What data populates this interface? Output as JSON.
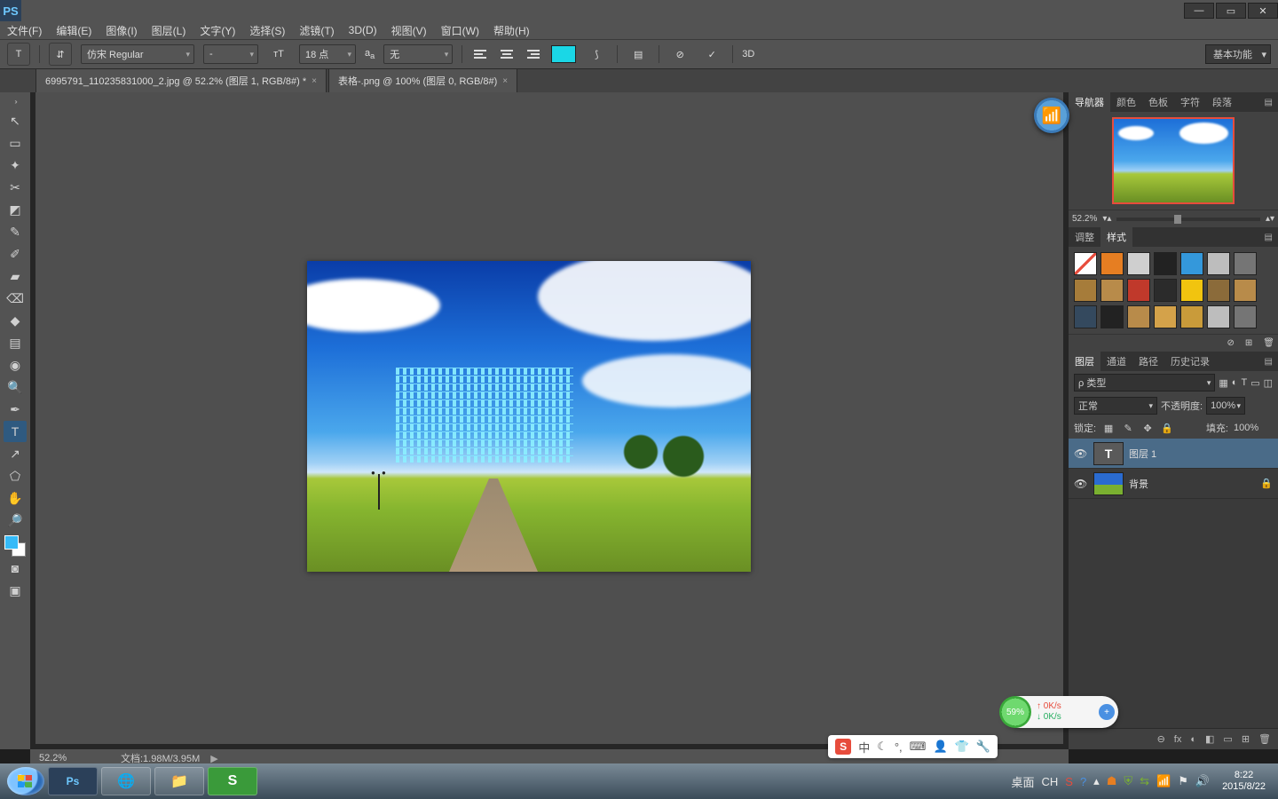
{
  "window": {
    "ps_label": "PS"
  },
  "menubar": [
    "文件(F)",
    "编辑(E)",
    "图像(I)",
    "图层(L)",
    "文字(Y)",
    "选择(S)",
    "滤镜(T)",
    "3D(D)",
    "视图(V)",
    "窗口(W)",
    "帮助(H)"
  ],
  "options": {
    "font": "仿宋 Regular",
    "style": "-",
    "size": "18 点",
    "aa": "无",
    "color": "#1ad7e6",
    "threed": "3D",
    "workspace": "基本功能"
  },
  "tabs": [
    {
      "label": "6995791_110235831000_2.jpg @ 52.2% (图层 1, RGB/8#) *"
    },
    {
      "label": "表格-.png @ 100% (图层 0, RGB/8#)"
    }
  ],
  "tools": [
    "↖",
    "▭",
    "✦",
    "✂",
    "◩",
    "✎",
    "✐",
    "▰",
    "⌫",
    "◆",
    "▤",
    "◉",
    "🔍",
    "✒",
    "T",
    "↗",
    "⬠",
    "✋",
    "🔎"
  ],
  "status": {
    "zoom": "52.2%",
    "doc": "文档:1.98M/3.95M"
  },
  "panels": {
    "nav_tabs": [
      "导航器",
      "颜色",
      "色板",
      "字符",
      "段落"
    ],
    "nav_zoom": "52.2%",
    "adj_tabs": [
      "调整",
      "样式"
    ],
    "style_colors": [
      "#ffffff",
      "#e67e22",
      "#cfcfcf",
      "#222222",
      "#3498db",
      "#bdbdbd",
      "#757575",
      "#a67c3a",
      "#b88b4a",
      "#c0392b",
      "#2b2b2b",
      "#f1c40f",
      "#8b6b3a",
      "#b88b4a",
      "#34495e",
      "#222222",
      "#b88b4a",
      "#d4a24a",
      "#c99b3a",
      "#bdbdbd",
      "#757575"
    ],
    "layer_tabs": [
      "图层",
      "通道",
      "路径",
      "历史记录"
    ],
    "layer_filter": "ρ 类型",
    "blend": "正常",
    "opacity_label": "不透明度:",
    "opacity": "100%",
    "lock_label": "锁定:",
    "fill_label": "填充:",
    "fill": "100%",
    "layers": [
      {
        "name": "图层 1",
        "type": "T",
        "active": true,
        "locked": false
      },
      {
        "name": "背景",
        "type": "img",
        "active": false,
        "locked": true
      }
    ],
    "footer_icons": [
      "⊖",
      "fx",
      "◐",
      "◧",
      "▭",
      "⊞",
      "🗑"
    ]
  },
  "netmon": {
    "pct": "59%",
    "up": "0K/s",
    "down": "0K/s"
  },
  "ime": {
    "s": "S",
    "items": [
      "中",
      "☾",
      "°,",
      "⌨",
      "👤",
      "👕",
      "🔧"
    ]
  },
  "taskbar": {
    "desktop": "桌面",
    "tray_text": [
      "CH"
    ],
    "time": "8:22",
    "date": "2015/8/22"
  },
  "layer_footer2_icons": [
    "⊕",
    "⊡",
    "🗑"
  ]
}
